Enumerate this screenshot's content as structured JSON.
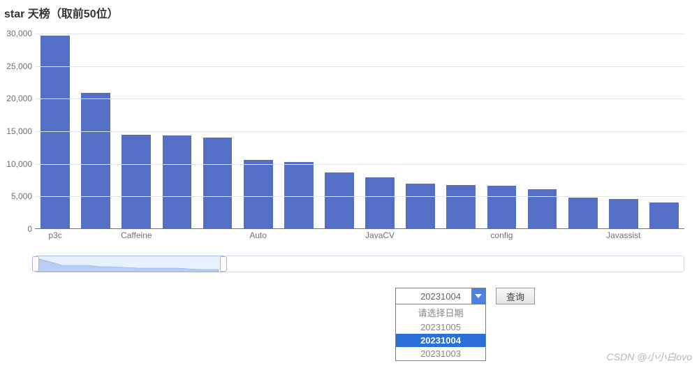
{
  "title": "star 天榜（取前50位）",
  "watermark": "CSDN @小小白ovo",
  "controls": {
    "selected": "20231004",
    "placeholder": "请选择日期",
    "options": [
      "20231005",
      "20231004",
      "20231003"
    ],
    "query_label": "查询"
  },
  "chart_data": {
    "type": "bar",
    "title": "star 天榜（取前50位）",
    "xlabel": "",
    "ylabel": "",
    "ylim": [
      0,
      30000
    ],
    "y_ticks": [
      0,
      5000,
      10000,
      15000,
      20000,
      25000,
      30000
    ],
    "y_tick_labels": [
      "0",
      "5,000",
      "10,000",
      "15,000",
      "20,000",
      "25,000",
      "30,000"
    ],
    "x_visible_labels": [
      "p3c",
      "",
      "Caffeine",
      "",
      "",
      "Auto",
      "",
      "",
      "JavaCV",
      "",
      "",
      "config",
      "",
      "",
      "Javassist"
    ],
    "categories": [
      "p3c",
      "",
      "Caffeine",
      "",
      "",
      "Auto",
      "",
      "",
      "JavaCV",
      "",
      "",
      "config",
      "",
      "",
      "Javassist"
    ],
    "values": [
      29700,
      20900,
      14400,
      14300,
      14000,
      10500,
      10200,
      8600,
      7900,
      6900,
      6700,
      6600,
      6000,
      4700,
      4500,
      4000
    ],
    "zoom": {
      "start_pct": 0,
      "end_pct": 29
    }
  }
}
